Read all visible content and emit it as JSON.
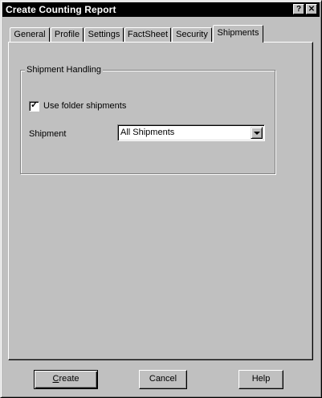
{
  "window": {
    "title": "Create Counting Report"
  },
  "titlebar_buttons": {
    "help": "?",
    "close": "✕"
  },
  "tabs": [
    {
      "label": "General"
    },
    {
      "label": "Profile"
    },
    {
      "label": "Settings"
    },
    {
      "label": "FactSheet"
    },
    {
      "label": "Security"
    },
    {
      "label": "Shipments",
      "active": true
    }
  ],
  "shipment_handling": {
    "group_label": "Shipment Handling",
    "use_folder_shipments": {
      "label": "Use folder shipments",
      "checked": true,
      "mark": "✓"
    },
    "shipment_label": "Shipment",
    "shipment_value": "All Shipments"
  },
  "buttons": {
    "create": "Create",
    "cancel": "Cancel",
    "help": "Help"
  }
}
